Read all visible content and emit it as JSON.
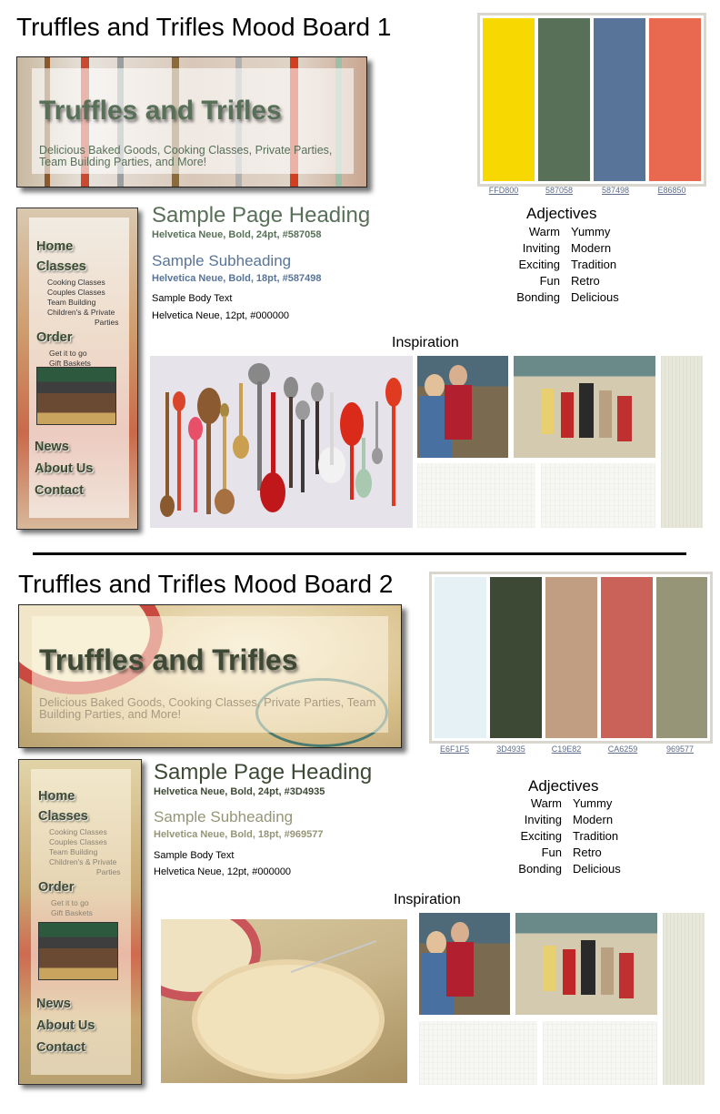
{
  "boards": [
    {
      "title": "Truffles and Trifles Mood Board 1",
      "banner": {
        "title": "Truffles and Trifles",
        "tagline": "Delicious Baked Goods, Cooking Classes, Private Parties, Team Building Parties, and More!"
      },
      "palette": [
        {
          "hex": "FFD800",
          "color": "#F7D800"
        },
        {
          "hex": "587058",
          "color": "#587058"
        },
        {
          "hex": "587498",
          "color": "#587498"
        },
        {
          "hex": "E86850",
          "color": "#E86850"
        }
      ],
      "nav": {
        "home": "Home",
        "classes": "Classes",
        "class_items": [
          "Cooking Classes",
          "Couples Classes",
          "Team Building",
          "Children's & Private",
          "Parties"
        ],
        "order": "Order",
        "order_items": [
          "Get it to go",
          "Gift Baskets"
        ],
        "news": "News",
        "about": "About Us",
        "contact": "Contact"
      },
      "sample": {
        "heading": "Sample Page Heading",
        "heading_spec": "Helvetica Neue, Bold, 24pt, #587058",
        "subheading": "Sample Subheading",
        "subheading_spec": "Helvetica Neue, Bold, 18pt, #587498",
        "body": "Sample Body Text",
        "body_spec": "Helvetica Neue, 12pt, #000000"
      },
      "adjectives": {
        "title": "Adjectives",
        "left": [
          "Warm",
          "Inviting",
          "Exciting",
          "Fun",
          "Bonding"
        ],
        "right": [
          "Yummy",
          "Modern",
          "Tradition",
          "Retro",
          "Delicious"
        ]
      },
      "inspiration": "Inspiration",
      "colors": {
        "heading": "#587058",
        "subheading": "#587498",
        "nav_text": "#3a4a2c"
      }
    },
    {
      "title": "Truffles and Trifles Mood Board 2",
      "banner": {
        "title": "Truffles and Trifles",
        "tagline": "Delicious Baked Goods, Cooking Classes, Private Parties, Team Building Parties, and More!"
      },
      "palette": [
        {
          "hex": "E6F1F5",
          "color": "#E6F1F5"
        },
        {
          "hex": "3D4935",
          "color": "#3D4935"
        },
        {
          "hex": "C19E82",
          "color": "#C19E82"
        },
        {
          "hex": "CA6259",
          "color": "#CA6259"
        },
        {
          "hex": "969577",
          "color": "#969577"
        }
      ],
      "nav": {
        "home": "Home",
        "classes": "Classes",
        "class_items": [
          "Cooking Classes",
          "Couples Classes",
          "Team Building",
          "Children's & Private",
          "Parties"
        ],
        "order": "Order",
        "order_items": [
          "Get it to go",
          "Gift Baskets"
        ],
        "news": "News",
        "about": "About Us",
        "contact": "Contact"
      },
      "sample": {
        "heading": "Sample Page Heading",
        "heading_spec": "Helvetica Neue, Bold, 24pt, #3D4935",
        "subheading": "Sample Subheading",
        "subheading_spec": "Helvetica Neue, Bold, 18pt, #969577",
        "body": "Sample Body Text",
        "body_spec": "Helvetica Neue, 12pt, #000000"
      },
      "adjectives": {
        "title": "Adjectives",
        "left": [
          "Warm",
          "Inviting",
          "Exciting",
          "Fun",
          "Bonding"
        ],
        "right": [
          "Yummy",
          "Modern",
          "Tradition",
          "Retro",
          "Delicious"
        ]
      },
      "inspiration": "Inspiration",
      "colors": {
        "heading": "#3D4935",
        "subheading": "#969577",
        "nav_text": "#3D4935"
      }
    }
  ]
}
